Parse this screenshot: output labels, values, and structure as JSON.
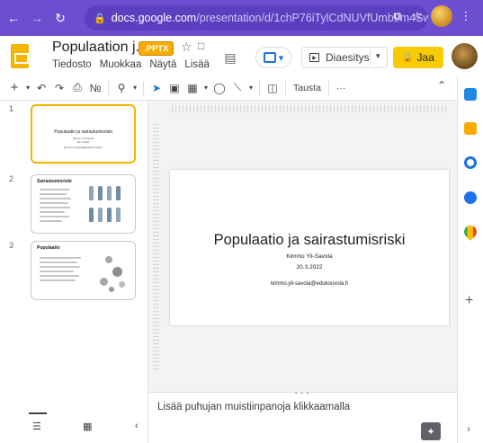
{
  "browser": {
    "url_host": "docs.google.com",
    "url_path": "/presentation/d/1chP76iTylCdNUVfUmb9m4SwkiyqYy..."
  },
  "header": {
    "doc_title": "Populaation j...",
    "format_badge": ".PPTX",
    "menu": [
      "Tiedosto",
      "Muokkaa",
      "Näytä",
      "Lisää"
    ],
    "slideshow_label": "Diaesitys",
    "share_label": "Jaa"
  },
  "toolbar": {
    "background_label": "Tausta",
    "more_label": "···"
  },
  "filmstrip": {
    "slides": [
      {
        "number": "1",
        "title": "Populaatio ja sairastumisriski",
        "lines": [
          "Kimmo Yli-Savola",
          "20.3.2022",
          "kimmo.yli-savola@edukouvola.fi"
        ]
      },
      {
        "number": "2",
        "title": "Sairastumisriski"
      },
      {
        "number": "3",
        "title": "Populaatio"
      }
    ]
  },
  "slide": {
    "title": "Populaatio ja sairastumisriski",
    "author": "Kimmo Yli-Savola",
    "date": "20.3.2022",
    "email": "kimmo.yli-savola@edukouvola.fi"
  },
  "notes": {
    "placeholder": "Lisää puhujan muistiinpanoja klikkaamalla"
  },
  "colors": {
    "browser_bar": "#6c4fd0",
    "slides_yellow": "#f4b400",
    "share_button": "#f9cb02",
    "accent_blue": "#1a73e8"
  }
}
